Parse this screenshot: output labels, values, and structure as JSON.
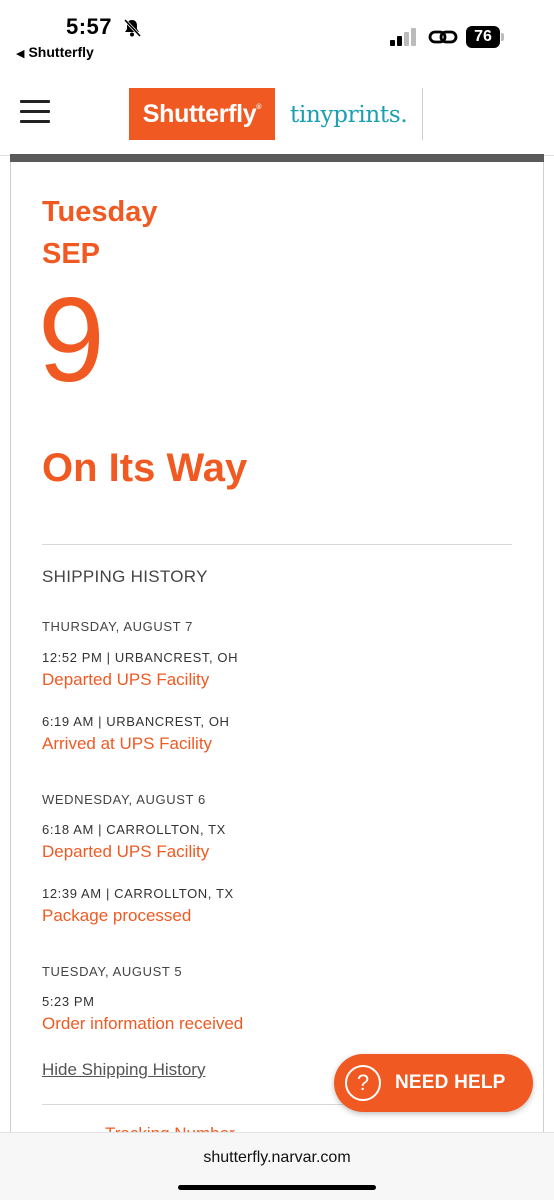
{
  "status_bar": {
    "time": "5:57",
    "back_app": "Shutterfly",
    "battery": "76"
  },
  "header": {
    "logo_primary": "Shutterfly",
    "logo_secondary": "tinyprints.",
    "brand_color": "#f05a22",
    "secondary_color": "#1aa0b0"
  },
  "delivery": {
    "day_name": "Tuesday",
    "month": "SEP",
    "day": "9",
    "status": "On Its Way"
  },
  "history": {
    "heading": "SHIPPING HISTORY",
    "groups": [
      {
        "date": "THURSDAY, AUGUST 7",
        "events": [
          {
            "meta": "12:52 PM | URBANCREST, OH",
            "desc": "Departed UPS Facility"
          },
          {
            "meta": "6:19 AM | URBANCREST, OH",
            "desc": "Arrived at UPS Facility"
          }
        ]
      },
      {
        "date": "WEDNESDAY, AUGUST 6",
        "events": [
          {
            "meta": "6:18 AM | CARROLLTON, TX",
            "desc": "Departed UPS Facility"
          },
          {
            "meta": "12:39 AM | CARROLLTON, TX",
            "desc": "Package processed"
          }
        ]
      },
      {
        "date": "TUESDAY, AUGUST 5",
        "events": [
          {
            "meta": "5:23 PM",
            "desc": "Order information received"
          }
        ]
      }
    ],
    "hide_link": "Hide Shipping History"
  },
  "tracking_peek": "Tracking Number",
  "need_help": {
    "icon": "question-icon",
    "label": "NEED HELP"
  },
  "browser": {
    "url": "shutterfly.narvar.com"
  }
}
